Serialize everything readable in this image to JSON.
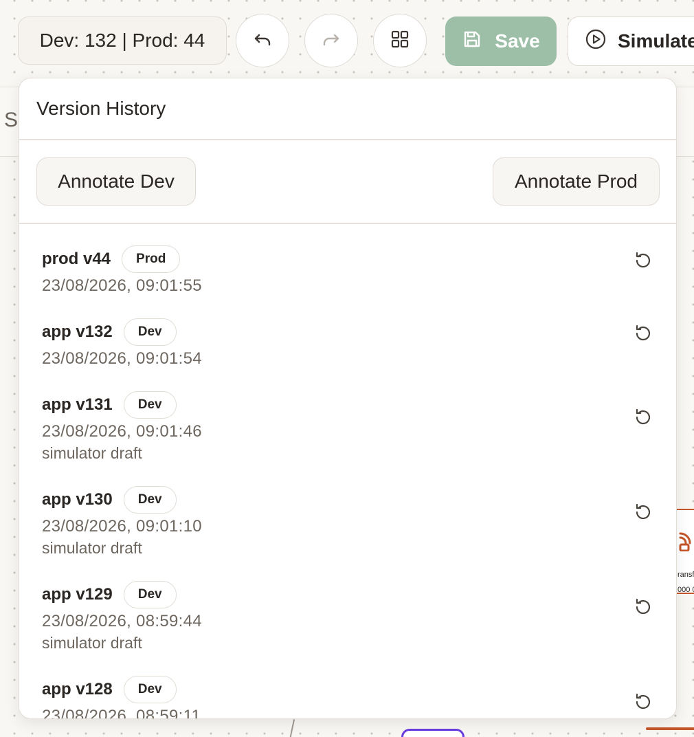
{
  "toolbar": {
    "version_chip": "Dev: 132 | Prod: 44",
    "undo_icon": "undo-icon",
    "redo_icon": "redo-icon",
    "grid_icon": "grid-icon",
    "save_label": "Save",
    "simulate_label": "Simulate"
  },
  "version_history": {
    "title": "Version History",
    "annotate_dev_label": "Annotate Dev",
    "annotate_prod_label": "Annotate Prod",
    "items": [
      {
        "name": "prod v44",
        "badge": "Prod",
        "time": "23/08/2026, 09:01:55",
        "note": ""
      },
      {
        "name": "app v132",
        "badge": "Dev",
        "time": "23/08/2026, 09:01:54",
        "note": ""
      },
      {
        "name": "app v131",
        "badge": "Dev",
        "time": "23/08/2026, 09:01:46",
        "note": "simulator draft"
      },
      {
        "name": "app v130",
        "badge": "Dev",
        "time": "23/08/2026, 09:01:10",
        "note": "simulator draft"
      },
      {
        "name": "app v129",
        "badge": "Dev",
        "time": "23/08/2026, 08:59:44",
        "note": "simulator draft"
      },
      {
        "name": "app v128",
        "badge": "Dev",
        "time": "23/08/2026, 08:59:11",
        "note": ""
      }
    ]
  },
  "canvas": {
    "peek_letter": "S",
    "peek_node_text_1": "ransf",
    "peek_node_text_2": "000 0"
  },
  "colors": {
    "save_bg": "#9dbfa7",
    "node_orange": "#c4562a",
    "node_purple": "#6a3de0"
  }
}
